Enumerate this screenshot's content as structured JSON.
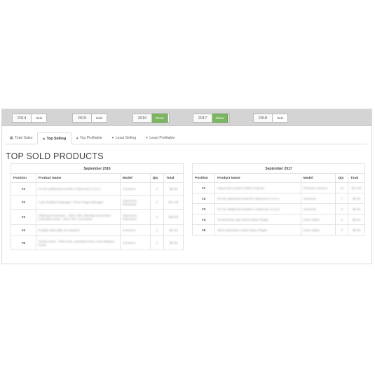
{
  "year_bar": [
    {
      "year": "2014",
      "toggle": "Hide"
    },
    {
      "year": "2015",
      "toggle": "Hide"
    },
    {
      "year": "2016",
      "toggle": "Show"
    },
    {
      "year": "2017",
      "toggle": "Show"
    },
    {
      "year": "2018",
      "toggle": "Hide"
    }
  ],
  "tabs": [
    {
      "label": "Total Sales",
      "icon": "table-icon",
      "glyph": "▦"
    },
    {
      "label": "Top Selling",
      "icon": "chevron-up-icon",
      "glyph": "▴"
    },
    {
      "label": "Top Profitable",
      "icon": "chevron-up-icon",
      "glyph": "▴"
    },
    {
      "label": "Least Selling",
      "icon": "chevron-down-icon",
      "glyph": "▾"
    },
    {
      "label": "Least Profitable",
      "icon": "chevron-down-icon",
      "glyph": "▾"
    }
  ],
  "active_tab": "Top Selling",
  "section_title": "TOP SOLD PRODUCTS",
  "columns": [
    "Position",
    "Product Name",
    "Model",
    "Qty",
    "Total"
  ],
  "tables": [
    {
      "period": "September 2016",
      "rows": [
        {
          "pos": "#1",
          "name": "Fix for additional emails in Opencart 2.3.0.2",
          "model": "Common",
          "qty": "4",
          "total": "$0.00"
        },
        {
          "pos": "#2",
          "name": "Auto Redirect Manager / Error Page Manager",
          "model": "OpenCart Extension",
          "qty": "2",
          "total": "$17.00"
        },
        {
          "pos": "#3",
          "name": "Sitemap Generator - SEO URL Sitemap Generator - Unlimited Links - SEO URL Generator",
          "model": "OpenCart Extension",
          "qty": "2",
          "total": "$30.00"
        },
        {
          "pos": "#4",
          "name": "Enable Meta title as required",
          "model": "Common",
          "qty": "2",
          "total": "$0.00"
        },
        {
          "pos": "#5",
          "name": "Social Icons - Flat icons, rounded icons, cool Shaped Icons",
          "model": "Common",
          "qty": "2",
          "total": "$0.00"
        }
      ]
    },
    {
      "period": "September 2017",
      "rows": [
        {
          "pos": "#1",
          "name": "OpenCart Custom Work Projects",
          "model": "Premium Service",
          "qty": "13",
          "total": "$14.00"
        },
        {
          "pos": "#2",
          "name": "Fix for password reset for OpenCart 2.3.0.2",
          "model": "Common",
          "qty": "7",
          "total": "$0.00"
        },
        {
          "pos": "#3",
          "name": "Fix for additional emails in Opencart 2.3.0.2",
          "model": "Common",
          "qty": "6",
          "total": "$0.00"
        },
        {
          "pos": "#4",
          "name": "Productivity App Admin Base Plugin",
          "model": "Free Addon",
          "qty": "4",
          "total": "$0.00"
        },
        {
          "pos": "#5",
          "name": "SEO Extension Admin Base Plugin",
          "model": "Free Addon",
          "qty": "3",
          "total": "$0.00"
        }
      ]
    }
  ]
}
